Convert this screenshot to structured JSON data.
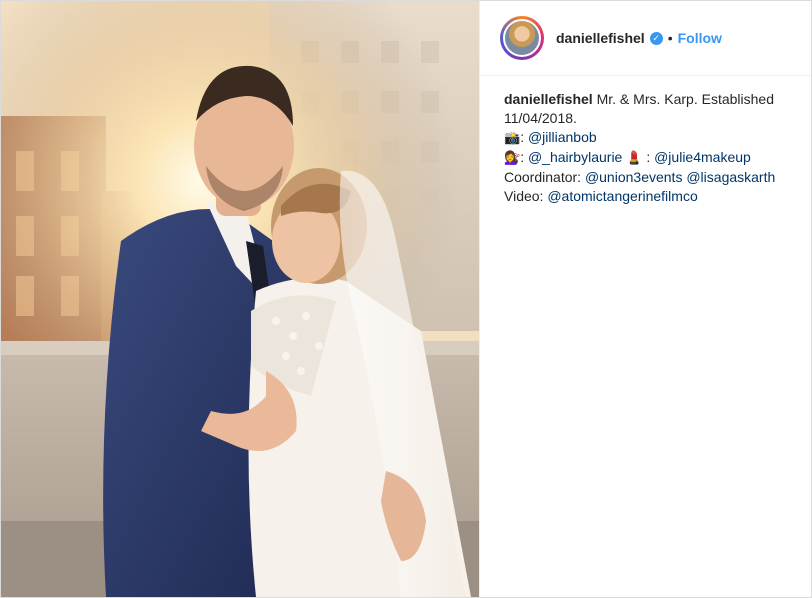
{
  "post": {
    "username": "daniellefishel",
    "verified_symbol": "✓",
    "separator": "•",
    "follow_label": "Follow",
    "photo_alt": "Wedding photo of a couple embracing at sunset on a rooftop",
    "caption": {
      "username": "daniellefishel",
      "line1_text": "Mr. & Mrs. Karp. Established",
      "line2_text": "11/04/2018.",
      "photo_credit": {
        "emoji": "📸",
        "colon": ":",
        "mention": "@jillianbob"
      },
      "hair_makeup": {
        "emoji_hair": "💇‍♀️",
        "colon1": ":",
        "mention_hair": "@_hairbylaurie",
        "emoji_lipstick": "💄",
        "colon2": ":",
        "mention_makeup": "@julie4makeup"
      },
      "coordinator": {
        "label": "Coordinator:",
        "mention1": "@union3events",
        "mention2": "@lisagaskarth"
      },
      "video": {
        "label": "Video:",
        "mention": "@atomictangerinefilmco"
      }
    }
  },
  "colors": {
    "link_blue": "#3897f0",
    "mention_blue": "#003569",
    "border": "#dbdbdb"
  }
}
